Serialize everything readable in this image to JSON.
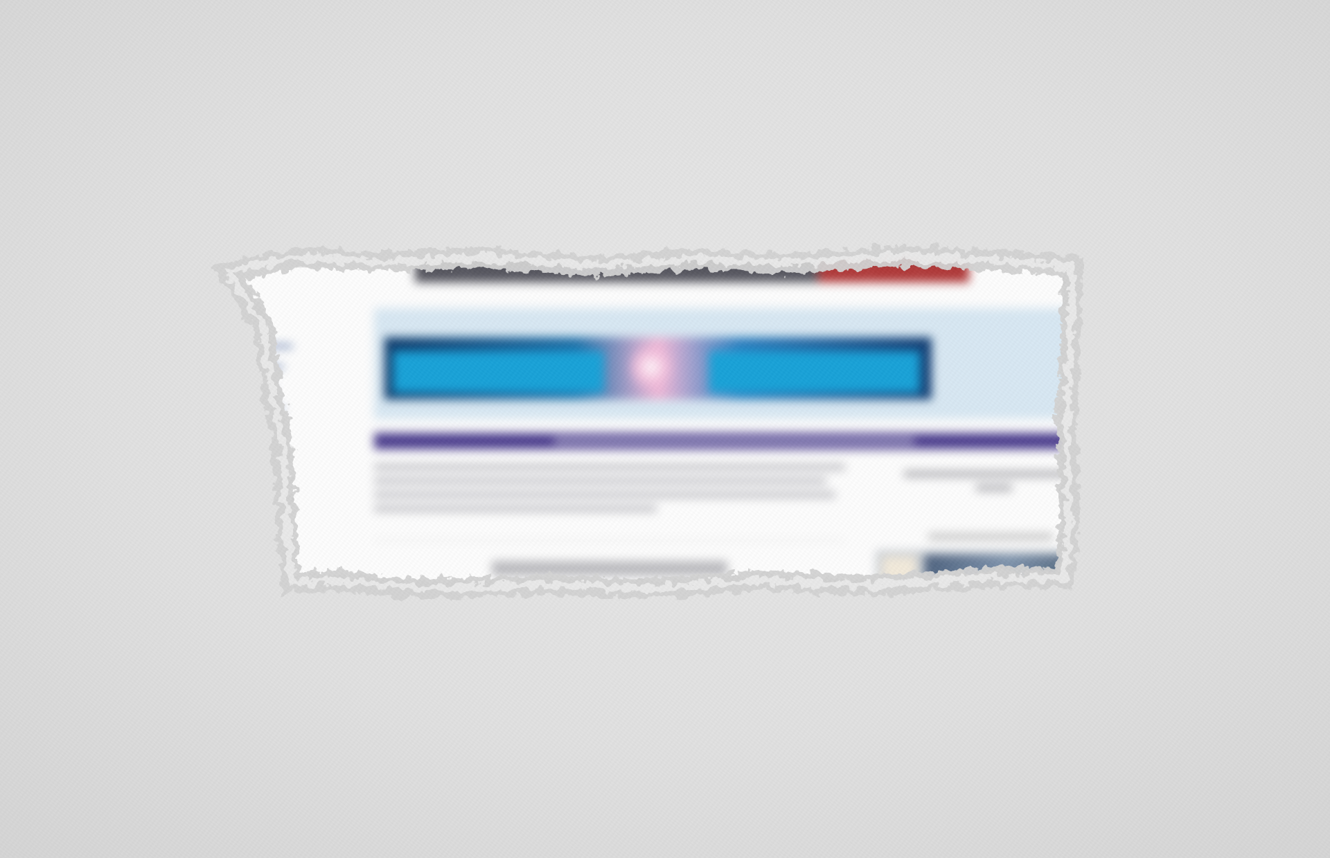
{
  "image": {
    "kind": "photo-illustration",
    "paper_color": "#e2e2e2",
    "hole_edge_color": "#d2d2d2"
  },
  "revealed_page": {
    "legible_text": [],
    "colors": {
      "page_background": "#fdfdfd",
      "header_panel": "#d8e8f3",
      "nav_bar": "#4d3f8f",
      "banner_blue": "#1c6fa8",
      "masthead_gray": "#56565f",
      "masthead_red": "#b03a3a"
    }
  }
}
